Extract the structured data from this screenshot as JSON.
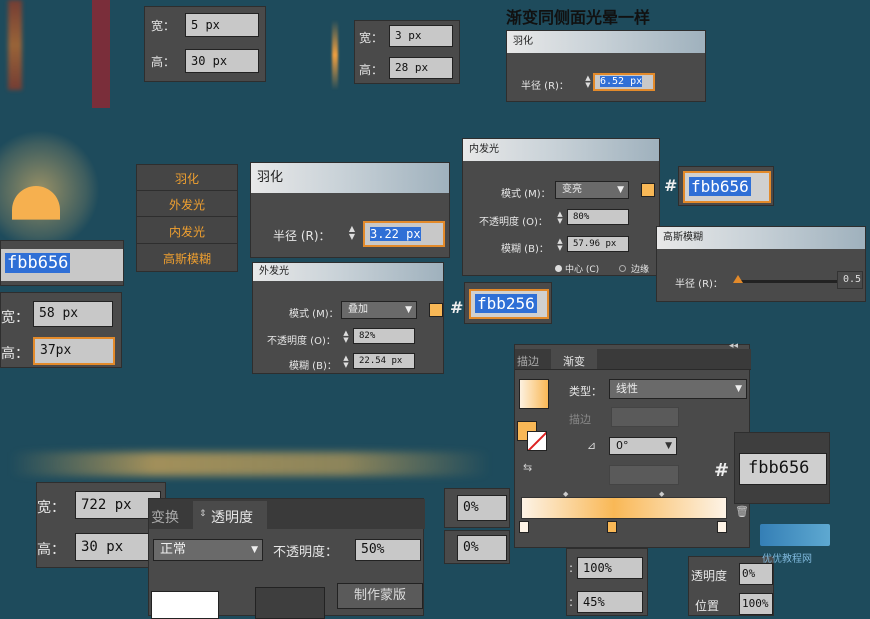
{
  "title": "渐变同侧面光晕一样",
  "colors": {
    "accent": "#e38a2a",
    "swatch": "#f9b856",
    "selection": "#2f6fd6",
    "bg": "#1e4b5c"
  },
  "wh_panel_a": {
    "width_label": "宽：",
    "width_value": "5 px",
    "height_label": "高：",
    "height_value": "30 px"
  },
  "wh_panel_b": {
    "width_label": "宽：",
    "width_value": "3 px",
    "height_label": "高：",
    "height_value": "28 px"
  },
  "feather_small": {
    "title": "羽化",
    "radius_label": "半径 (R)：",
    "radius_value": "6.52 px"
  },
  "effects_menu": {
    "items": [
      "羽化",
      "外发光",
      "内发光",
      "高斯模糊"
    ]
  },
  "feather_dialog": {
    "title": "羽化",
    "radius_label": "半径 (R)：",
    "radius_value": "3.22 px"
  },
  "inner_glow": {
    "title": "内发光",
    "mode_label": "模式 (M)：",
    "mode_value": "变亮",
    "opacity_label": "不透明度 (O)：",
    "opacity_value": "80%",
    "blur_label": "模糊 (B)：",
    "blur_value": "57.96 px",
    "center_label": "中心 (C)",
    "edge_label": "边缘",
    "hex": "fbb656"
  },
  "gaussian_blur": {
    "title": "高斯模糊",
    "radius_label": "半径 (R)：",
    "radius_value": "0.5"
  },
  "left_hex": "fbb656",
  "wh_panel_c": {
    "width_label": "宽：",
    "width_value": "58 px",
    "height_label": "高：",
    "height_value": "37px"
  },
  "outer_glow": {
    "title": "外发光",
    "mode_label": "模式 (M)：",
    "mode_value": "叠加",
    "opacity_label": "不透明度 (O)：",
    "opacity_value": "82%",
    "blur_label": "模糊 (B)：",
    "blur_value": "22.54 px",
    "hex": "fbb256"
  },
  "gradient_panel": {
    "tab_stroke": "描边",
    "tab_gradient": "渐变",
    "type_label": "类型：",
    "type_value": "线性",
    "stroke_label": "描边",
    "angle_value": "0°",
    "hex": "fbb656"
  },
  "wh_panel_d": {
    "width_label": "宽：",
    "width_value": "722 px",
    "height_label": "高：",
    "height_value": "30 px"
  },
  "transparency_panel": {
    "tab_transform": "变换",
    "tab_transparency": "透明度",
    "blend_value": "正常",
    "opacity_label": "不透明度：",
    "opacity_value": "50%",
    "mask_button": "制作蒙版"
  },
  "percent_fields": {
    "a": "0%",
    "b": "0%",
    "c": "100%",
    "d": "45%"
  },
  "stop_panel": {
    "opacity_label": "透明度",
    "opacity_value": "0%",
    "position_label": "位置",
    "position_value": "100%"
  },
  "watermark": {
    "text": "优优教程网"
  }
}
